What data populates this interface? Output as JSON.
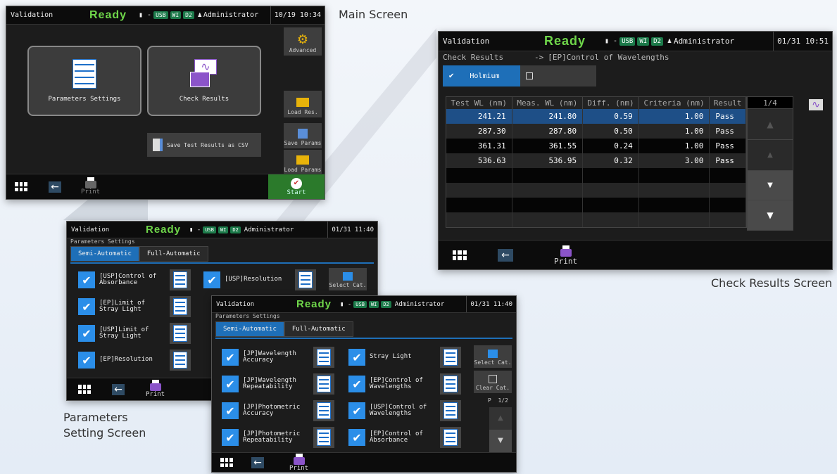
{
  "captions": {
    "main": "Main Screen",
    "check": "Check Results Screen",
    "params_line1": "Parameters",
    "params_line2": "Setting Screen"
  },
  "status_bar": {
    "app": "Validation",
    "ready": "Ready",
    "dash": "▮ -",
    "usb": "USB",
    "wi": "WI",
    "d2": "D2",
    "user": "Administrator"
  },
  "main_screen": {
    "time": "10/19 10:34",
    "params_button": "Parameters Settings",
    "check_button": "Check Results",
    "advanced": "Advanced",
    "load_res": "Load Res.",
    "save_params": "Save Params",
    "load_params": "Load Params",
    "save_csv": "Save Test Results as CSV",
    "print": "Print",
    "start": "Start"
  },
  "check_screen": {
    "time": "01/31 10:51",
    "breadcrumb": "Check Results",
    "arrow": "->",
    "test_name": "[EP]Control of Wavelengths",
    "tab_holmium": "Holmium",
    "headers": [
      "Test WL (nm)",
      "Meas. WL (nm)",
      "Diff. (nm)",
      "Criteria (nm)",
      "Result"
    ],
    "page": "1/4",
    "rows": [
      [
        "241.21",
        "241.80",
        "0.59",
        "1.00",
        "Pass"
      ],
      [
        "287.30",
        "287.80",
        "0.50",
        "1.00",
        "Pass"
      ],
      [
        "361.31",
        "361.55",
        "0.24",
        "1.00",
        "Pass"
      ],
      [
        "536.63",
        "536.95",
        "0.32",
        "3.00",
        "Pass"
      ]
    ],
    "print": "Print"
  },
  "params_back": {
    "time": "01/31 11:40",
    "breadcrumb": "Parameters Settings",
    "tab_semi": "Semi-Automatic",
    "tab_full": "Full-Automatic",
    "items": [
      "[USP]Control of Absorbance",
      "[USP]Resolution",
      "[EP]Limit of Stray Light",
      "[USP]Limit of Stray Light",
      "[EP]Resolution"
    ],
    "select_cat": "Select Cat.",
    "print": "Print"
  },
  "params_front": {
    "time": "01/31 11:40",
    "breadcrumb": "Parameters Settings",
    "tab_semi": "Semi-Automatic",
    "tab_full": "Full-Automatic",
    "items_left": [
      "[JP]Wavelength Accuracy",
      "[JP]Wavelength Repeatability",
      "[JP]Photometric Accuracy",
      "[JP]Photometric Repeatability"
    ],
    "items_right": [
      "Stray Light",
      "[EP]Control of Wavelengths",
      "[USP]Control of Wavelengths",
      "[EP]Control of Absorbance"
    ],
    "select_cat": "Select Cat.",
    "clear_cat": "Clear Cat.",
    "page": "P  1/2",
    "print": "Print"
  }
}
